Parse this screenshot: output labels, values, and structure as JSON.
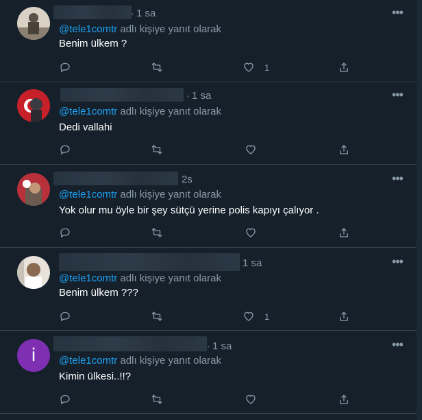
{
  "tweets": [
    {
      "time": "1 sa",
      "reply_prefix": "@tele1comtr",
      "reply_suffix": " adlı kişiye yanıt olarak",
      "text": "Benim ülkem ?",
      "like_count": "1",
      "avatar_color": "#cfc8b8"
    },
    {
      "time": "1 sa",
      "reply_prefix": "@tele1comtr",
      "reply_suffix": " adlı kişiye yanıt olarak",
      "text": "Dedi vallahi",
      "like_count": "",
      "avatar_color": "#c8202a"
    },
    {
      "time": "2s",
      "reply_prefix": "@tele1comtr",
      "reply_suffix": " adlı kişiye yanıt olarak",
      "text": "Yok olur mu öyle bir şey sütçü yerine polis kapıyı çalıyor .",
      "like_count": "",
      "avatar_color": "#b8303a"
    },
    {
      "time": "1 sa",
      "reply_prefix": "@tele1comtr",
      "reply_suffix": " adlı kişiye yanıt olarak",
      "text": "Benim ülkem ???",
      "like_count": "1",
      "avatar_color": "#e8e2da"
    },
    {
      "time": "1 sa",
      "reply_prefix": "@tele1comtr",
      "reply_suffix": " adlı kişiye yanıt olarak",
      "text": "Kimin ülkesi..!!?",
      "like_count": "",
      "avatar_color": "#7e2fb2",
      "avatar_letter": "i"
    }
  ],
  "more_glyph": "•••",
  "dot": "·",
  "colors": {
    "background": "#15202b",
    "link": "#1da1f2",
    "muted": "#8899a6",
    "divider": "#38444d"
  }
}
